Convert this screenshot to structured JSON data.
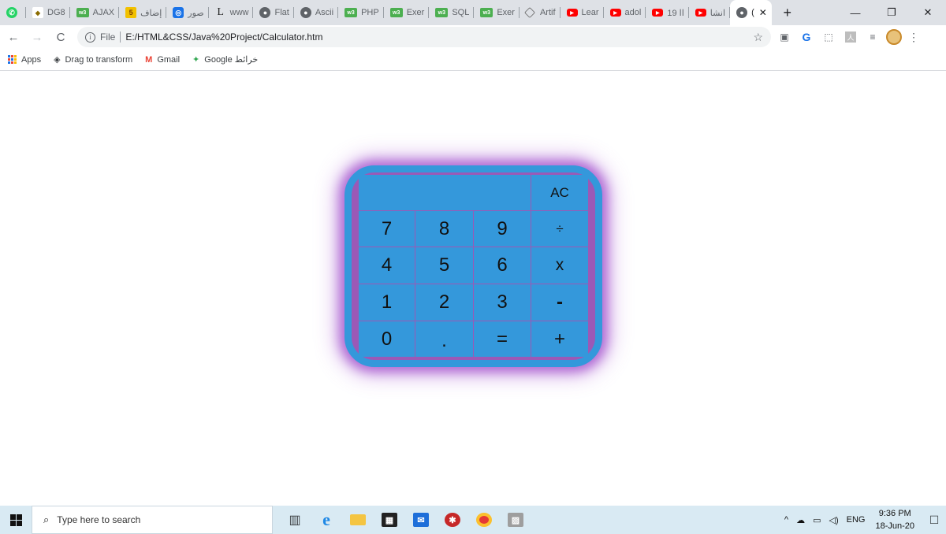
{
  "browser": {
    "tabs": [
      {
        "title": "",
        "icon": "whatsapp-icon"
      },
      {
        "title": "DG8",
        "icon": "dg-icon"
      },
      {
        "title": "AJAX",
        "icon": "w3schools-icon"
      },
      {
        "title": "إضاف",
        "icon": "html5-icon"
      },
      {
        "title": "صور",
        "icon": "camera-icon"
      },
      {
        "title": "www",
        "icon": "l-icon"
      },
      {
        "title": "Flat",
        "icon": "globe-icon"
      },
      {
        "title": "Ascii",
        "icon": "globe-icon"
      },
      {
        "title": "PHP",
        "icon": "w3schools-icon"
      },
      {
        "title": "Exer",
        "icon": "w3schools-icon"
      },
      {
        "title": "SQL",
        "icon": "w3schools-icon"
      },
      {
        "title": "Exer",
        "icon": "w3schools-icon"
      },
      {
        "title": "Artif",
        "icon": "ai-icon"
      },
      {
        "title": "Lear",
        "icon": "youtube-icon"
      },
      {
        "title": "adol",
        "icon": "youtube-icon"
      },
      {
        "title": "19 اا",
        "icon": "youtube-icon"
      },
      {
        "title": "انشا",
        "icon": "youtube-icon"
      },
      {
        "title": "(",
        "icon": "globe-icon",
        "active": true
      }
    ],
    "active_tab_close": "✕",
    "new_tab": "+",
    "window_controls": {
      "minimize": "—",
      "restore": "❐",
      "close": "✕"
    },
    "nav": {
      "back": "←",
      "forward": "→",
      "reload": "C"
    },
    "address": {
      "scheme": "File",
      "url": "E:/HTML&CSS/Java%20Project/Calculator.htm",
      "info": "i",
      "star": "☆"
    },
    "extensions": {
      "grammarly": "G",
      "pdf": "人",
      "reading": "≡"
    },
    "menu": "⋮",
    "bookmarks": [
      {
        "label": "Apps",
        "icon": "apps-icon"
      },
      {
        "label": "Drag to transform",
        "icon": "transform-icon"
      },
      {
        "label": "Gmail",
        "icon": "gmail-icon"
      },
      {
        "label": "Google خرائط",
        "icon": "maps-icon"
      }
    ]
  },
  "calculator": {
    "display": "",
    "keys": {
      "clear": "AC",
      "seven": "7",
      "eight": "8",
      "nine": "9",
      "divide": "÷",
      "four": "4",
      "five": "5",
      "six": "6",
      "multiply": "x",
      "one": "1",
      "two": "2",
      "three": "3",
      "subtract": "-",
      "zero": "0",
      "decimal": ".",
      "equals": "=",
      "add": "+"
    },
    "colors": {
      "key_bg": "#3498db",
      "frame": "#9b59b6",
      "border": "#3498db"
    }
  },
  "taskbar": {
    "search_placeholder": "Type here to search",
    "tray": {
      "chevron": "^",
      "language": "ENG"
    },
    "clock": {
      "time": "9:36 PM",
      "date": "18-Jun-20"
    },
    "notifications": "☐"
  }
}
